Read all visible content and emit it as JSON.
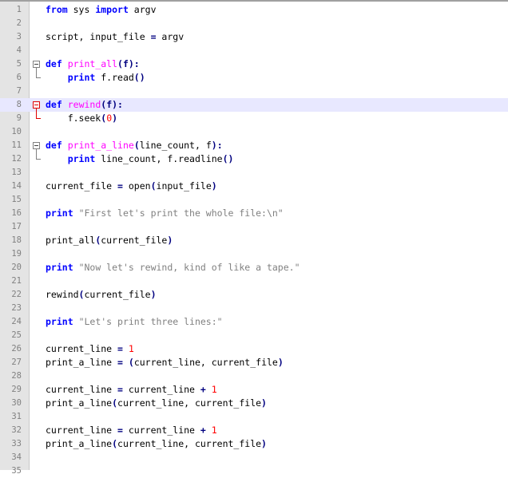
{
  "editor": {
    "current_line": 8,
    "lines": [
      {
        "n": "1",
        "fold": "",
        "tokens": [
          {
            "t": "from",
            "c": "kw"
          },
          {
            "t": " sys "
          },
          {
            "t": "import",
            "c": "kw"
          },
          {
            "t": " argv"
          }
        ]
      },
      {
        "n": "2",
        "fold": "",
        "tokens": []
      },
      {
        "n": "3",
        "fold": "",
        "tokens": [
          {
            "t": "script, input_file "
          },
          {
            "t": "=",
            "c": "op"
          },
          {
            "t": " argv"
          }
        ]
      },
      {
        "n": "4",
        "fold": "",
        "tokens": []
      },
      {
        "n": "5",
        "fold": "open",
        "tokens": [
          {
            "t": "def",
            "c": "kw"
          },
          {
            "t": " "
          },
          {
            "t": "print_all",
            "c": "fn"
          },
          {
            "t": "(f):",
            "c": "op"
          }
        ]
      },
      {
        "n": "6",
        "fold": "end",
        "tokens": [
          {
            "t": "    "
          },
          {
            "t": "print",
            "c": "kw"
          },
          {
            "t": " f.read"
          },
          {
            "t": "()",
            "c": "op"
          }
        ]
      },
      {
        "n": "7",
        "fold": "",
        "tokens": []
      },
      {
        "n": "8",
        "fold": "open-active",
        "tokens": [
          {
            "t": "def",
            "c": "kw"
          },
          {
            "t": " "
          },
          {
            "t": "rewind",
            "c": "fn"
          },
          {
            "t": "(f):",
            "c": "op"
          }
        ]
      },
      {
        "n": "9",
        "fold": "end-active",
        "tokens": [
          {
            "t": "    f.seek"
          },
          {
            "t": "(",
            "c": "op"
          },
          {
            "t": "0",
            "c": "num"
          },
          {
            "t": ")",
            "c": "op"
          }
        ]
      },
      {
        "n": "10",
        "fold": "",
        "tokens": []
      },
      {
        "n": "11",
        "fold": "open",
        "tokens": [
          {
            "t": "def",
            "c": "kw"
          },
          {
            "t": " "
          },
          {
            "t": "print_a_line",
            "c": "fn"
          },
          {
            "t": "(",
            "c": "op"
          },
          {
            "t": "line_count, f"
          },
          {
            "t": "):",
            "c": "op"
          }
        ]
      },
      {
        "n": "12",
        "fold": "end",
        "tokens": [
          {
            "t": "    "
          },
          {
            "t": "print",
            "c": "kw"
          },
          {
            "t": " line_count, f.readline"
          },
          {
            "t": "()",
            "c": "op"
          }
        ]
      },
      {
        "n": "13",
        "fold": "",
        "tokens": []
      },
      {
        "n": "14",
        "fold": "",
        "tokens": [
          {
            "t": "current_file "
          },
          {
            "t": "=",
            "c": "op"
          },
          {
            "t": " open"
          },
          {
            "t": "(",
            "c": "op"
          },
          {
            "t": "input_file"
          },
          {
            "t": ")",
            "c": "op"
          }
        ]
      },
      {
        "n": "15",
        "fold": "",
        "tokens": []
      },
      {
        "n": "16",
        "fold": "",
        "tokens": [
          {
            "t": "print",
            "c": "kw"
          },
          {
            "t": " "
          },
          {
            "t": "\"First let's print the whole file:\\n\"",
            "c": "str"
          }
        ]
      },
      {
        "n": "17",
        "fold": "",
        "tokens": []
      },
      {
        "n": "18",
        "fold": "",
        "tokens": [
          {
            "t": "print_all"
          },
          {
            "t": "(",
            "c": "op"
          },
          {
            "t": "current_file"
          },
          {
            "t": ")",
            "c": "op"
          }
        ]
      },
      {
        "n": "19",
        "fold": "",
        "tokens": []
      },
      {
        "n": "20",
        "fold": "",
        "tokens": [
          {
            "t": "print",
            "c": "kw"
          },
          {
            "t": " "
          },
          {
            "t": "\"Now let's rewind, kind of like a tape.\"",
            "c": "str"
          }
        ]
      },
      {
        "n": "21",
        "fold": "",
        "tokens": []
      },
      {
        "n": "22",
        "fold": "",
        "tokens": [
          {
            "t": "rewind"
          },
          {
            "t": "(",
            "c": "op"
          },
          {
            "t": "current_file"
          },
          {
            "t": ")",
            "c": "op"
          }
        ]
      },
      {
        "n": "23",
        "fold": "",
        "tokens": []
      },
      {
        "n": "24",
        "fold": "",
        "tokens": [
          {
            "t": "print",
            "c": "kw"
          },
          {
            "t": " "
          },
          {
            "t": "\"Let's print three lines:\"",
            "c": "str"
          }
        ]
      },
      {
        "n": "25",
        "fold": "",
        "tokens": []
      },
      {
        "n": "26",
        "fold": "",
        "tokens": [
          {
            "t": "current_line "
          },
          {
            "t": "=",
            "c": "op"
          },
          {
            "t": " "
          },
          {
            "t": "1",
            "c": "num"
          }
        ]
      },
      {
        "n": "27",
        "fold": "",
        "tokens": [
          {
            "t": "print_a_line "
          },
          {
            "t": "=",
            "c": "op"
          },
          {
            "t": " "
          },
          {
            "t": "(",
            "c": "op"
          },
          {
            "t": "current_line, current_file"
          },
          {
            "t": ")",
            "c": "op"
          }
        ]
      },
      {
        "n": "28",
        "fold": "",
        "tokens": []
      },
      {
        "n": "29",
        "fold": "",
        "tokens": [
          {
            "t": "current_line "
          },
          {
            "t": "=",
            "c": "op"
          },
          {
            "t": " current_line "
          },
          {
            "t": "+",
            "c": "op"
          },
          {
            "t": " "
          },
          {
            "t": "1",
            "c": "num"
          }
        ]
      },
      {
        "n": "30",
        "fold": "",
        "tokens": [
          {
            "t": "print_a_line"
          },
          {
            "t": "(",
            "c": "op"
          },
          {
            "t": "current_line, current_file"
          },
          {
            "t": ")",
            "c": "op"
          }
        ]
      },
      {
        "n": "31",
        "fold": "",
        "tokens": []
      },
      {
        "n": "32",
        "fold": "",
        "tokens": [
          {
            "t": "current_line "
          },
          {
            "t": "=",
            "c": "op"
          },
          {
            "t": " current_line "
          },
          {
            "t": "+",
            "c": "op"
          },
          {
            "t": " "
          },
          {
            "t": "1",
            "c": "num"
          }
        ]
      },
      {
        "n": "33",
        "fold": "",
        "tokens": [
          {
            "t": "print_a_line"
          },
          {
            "t": "(",
            "c": "op"
          },
          {
            "t": "current_line, current_file"
          },
          {
            "t": ")",
            "c": "op"
          }
        ]
      },
      {
        "n": "34",
        "fold": "",
        "tokens": []
      },
      {
        "n": "35",
        "fold": "",
        "tokens": []
      }
    ]
  },
  "colors": {
    "keyword": "#0000ff",
    "function_name": "#ff00ff",
    "string": "#808080",
    "number": "#ff0000",
    "operator": "#000080",
    "current_line_bg": "#e8e8ff",
    "gutter_bg": "#e4e4e4"
  }
}
